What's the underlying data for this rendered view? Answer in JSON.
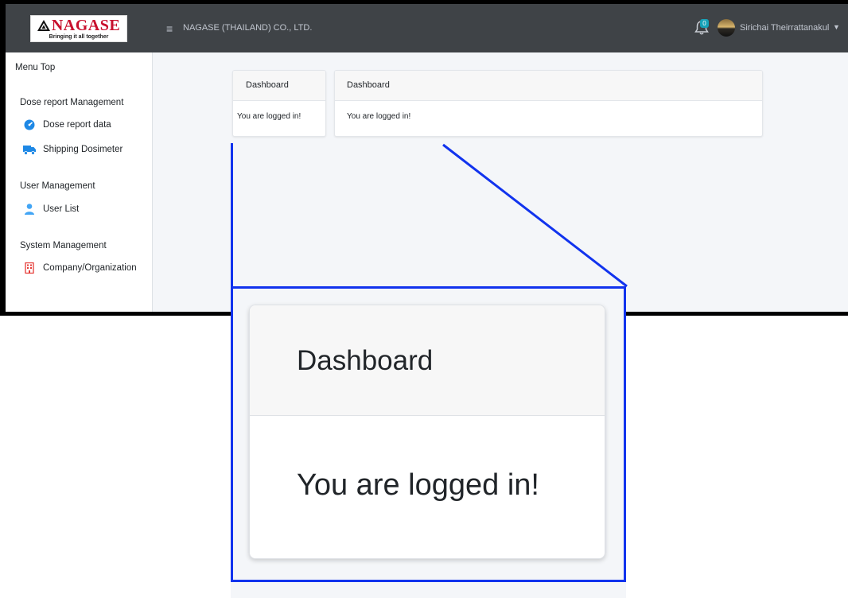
{
  "header": {
    "logo_text": "NAGASE",
    "logo_tagline": "Bringing it all together",
    "company_name": "NAGASE (THAILAND) CO., LTD.",
    "notification_count": "0",
    "username": "Sirichai Theirrattanakul"
  },
  "sidebar": {
    "menu_top": "Menu Top",
    "sections": [
      {
        "title": "Dose report Management",
        "items": [
          {
            "label": "Dose report data",
            "icon": "dashboard-gauge-icon"
          },
          {
            "label": "Shipping Dosimeter",
            "icon": "truck-icon"
          }
        ]
      },
      {
        "title": "User Management",
        "items": [
          {
            "label": "User List",
            "icon": "user-icon"
          }
        ]
      },
      {
        "title": "System Management",
        "items": [
          {
            "label": "Company/Organization",
            "icon": "building-icon"
          }
        ]
      }
    ]
  },
  "cards": [
    {
      "title": "Dashboard",
      "body": "You are logged in!"
    },
    {
      "title": "Dashboard",
      "body": "You are logged in!"
    }
  ],
  "zoom": {
    "title": "Dashboard",
    "body": "You are logged in!"
  },
  "colors": {
    "topbar": "#3f4347",
    "callout": "#1133ee",
    "brand_red": "#c8102e"
  }
}
